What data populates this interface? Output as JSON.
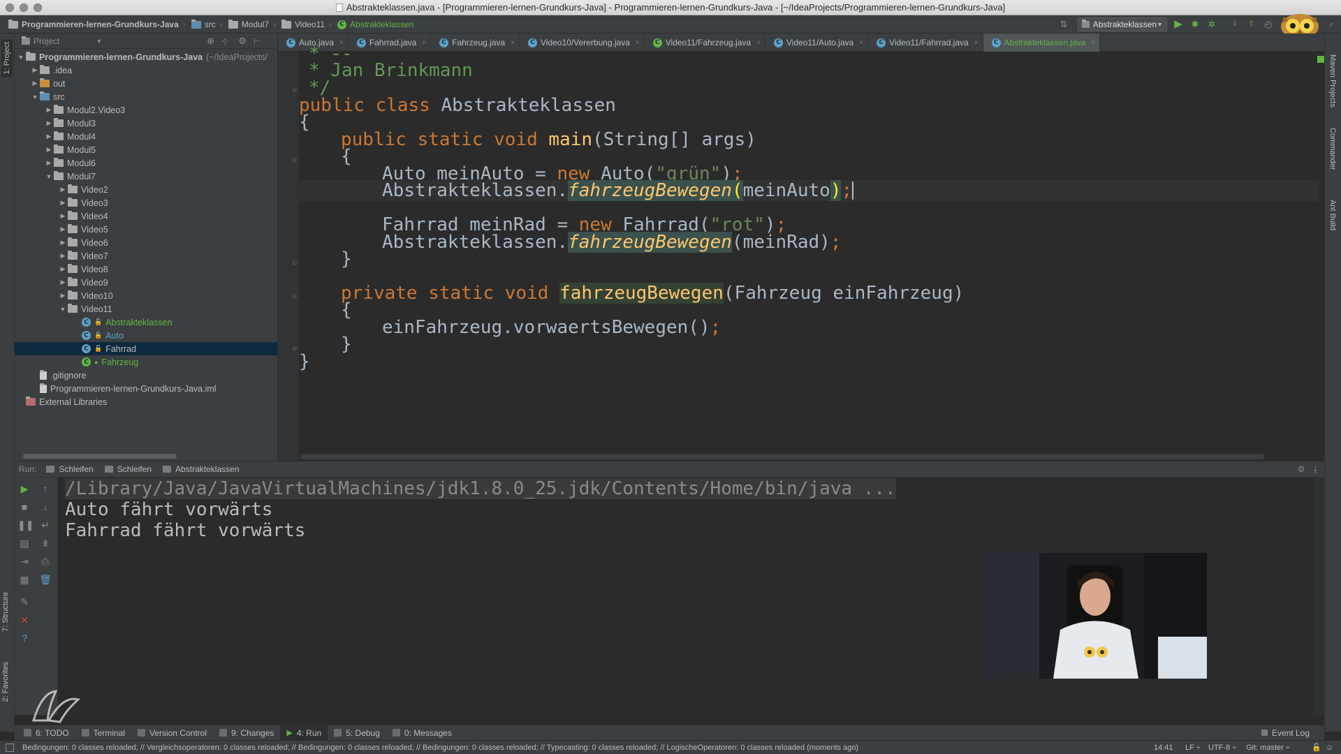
{
  "window": {
    "title": "Abstrakteklassen.java - [Programmieren-lernen-Grundkurs-Java] - Programmieren-lernen-Grundkurs-Java - [~/IdeaProjects/Programmieren-lernen-Grundkurs-Java]"
  },
  "navbar": {
    "crumbs": [
      "Programmieren-lernen-Grundkurs-Java",
      "src",
      "Modul7",
      "Video11",
      "Abstrakteklassen"
    ],
    "run_config": "Abstrakteklassen"
  },
  "left_stripe": {
    "project_tab": "1: Project",
    "structure_tab": "7: Structure",
    "favorites_tab": "2: Favorites"
  },
  "right_stripe": {
    "maven": "Maven Projects",
    "commander": "Commander",
    "ant": "Ant Build"
  },
  "project_panel": {
    "header": "Project",
    "root": "Programmieren-lernen-Grundkurs-Java",
    "root_path": "(~/IdeaProjects/",
    "tree": [
      {
        "label": ".idea",
        "level": 1,
        "state": "collapsed",
        "kind": "folder"
      },
      {
        "label": "out",
        "level": 1,
        "state": "collapsed",
        "kind": "folder-orange"
      },
      {
        "label": "src",
        "level": 1,
        "state": "expanded",
        "kind": "folder-blue"
      },
      {
        "label": "Modul2.Video3",
        "level": 2,
        "state": "collapsed",
        "kind": "folder"
      },
      {
        "label": "Modul3",
        "level": 2,
        "state": "collapsed",
        "kind": "folder"
      },
      {
        "label": "Modul4",
        "level": 2,
        "state": "collapsed",
        "kind": "folder"
      },
      {
        "label": "Modul5",
        "level": 2,
        "state": "collapsed",
        "kind": "folder"
      },
      {
        "label": "Modul6",
        "level": 2,
        "state": "collapsed",
        "kind": "folder"
      },
      {
        "label": "Modul7",
        "level": 2,
        "state": "expanded",
        "kind": "folder"
      },
      {
        "label": "Video2",
        "level": 3,
        "state": "collapsed",
        "kind": "folder"
      },
      {
        "label": "Video3",
        "level": 3,
        "state": "collapsed",
        "kind": "folder"
      },
      {
        "label": "Video4",
        "level": 3,
        "state": "collapsed",
        "kind": "folder"
      },
      {
        "label": "Video5",
        "level": 3,
        "state": "collapsed",
        "kind": "folder"
      },
      {
        "label": "Video6",
        "level": 3,
        "state": "collapsed",
        "kind": "folder"
      },
      {
        "label": "Video7",
        "level": 3,
        "state": "collapsed",
        "kind": "folder"
      },
      {
        "label": "Video8",
        "level": 3,
        "state": "collapsed",
        "kind": "folder"
      },
      {
        "label": "Video9",
        "level": 3,
        "state": "collapsed",
        "kind": "folder"
      },
      {
        "label": "Video10",
        "level": 3,
        "state": "collapsed",
        "kind": "folder"
      },
      {
        "label": "Video11",
        "level": 3,
        "state": "expanded",
        "kind": "folder"
      },
      {
        "label": "Abstrakteklassen",
        "level": 4,
        "state": "leaf",
        "kind": "class-green"
      },
      {
        "label": "Auto",
        "level": 4,
        "state": "leaf",
        "kind": "class-blue"
      },
      {
        "label": "Fahrrad",
        "level": 4,
        "state": "leaf",
        "kind": "class-selected"
      },
      {
        "label": "Fahrzeug",
        "level": 4,
        "state": "leaf",
        "kind": "class-abstract"
      },
      {
        "label": ".gitignore",
        "level": 1,
        "state": "leaf",
        "kind": "file"
      },
      {
        "label": "Programmieren-lernen-Grundkurs-Java.iml",
        "level": 1,
        "state": "leaf",
        "kind": "iml"
      },
      {
        "label": "External Libraries",
        "level": 0,
        "state": "leaf",
        "kind": "library"
      }
    ]
  },
  "editor_tabs": [
    {
      "label": "Auto.java",
      "active": false
    },
    {
      "label": "Fahrrad.java",
      "active": false
    },
    {
      "label": "Fahrzeug.java",
      "active": false
    },
    {
      "label": "Video10/Vererbung.java",
      "active": false
    },
    {
      "label": "Video11/Fahrzeug.java",
      "active": false
    },
    {
      "label": "Video11/Auto.java",
      "active": false
    },
    {
      "label": "Video11/Fahrrad.java",
      "active": false
    },
    {
      "label": "Abstrakteklassen.java",
      "active": true
    }
  ],
  "code": {
    "l1": "* --",
    "l2": "* Jan Brinkmann",
    "l3": "*/",
    "l4_kw": "public class ",
    "l4_name": "Abstrakteklassen",
    "l5": "{",
    "l6_kw": "public static void ",
    "l6_fn": "main",
    "l6_rest": "(String[] args)",
    "l7": "{",
    "l8_a": "Auto meinAuto = ",
    "l8_kw": "new ",
    "l8_b": "Auto(",
    "l8_str": "\"grün\"",
    "l8_c": ")",
    "l8_semi": ";",
    "l9_a": "Abstrakteklassen.",
    "l9_fn": "fahrzeugBewegen",
    "l9_open": "(",
    "l9_arg": "meinAuto",
    "l9_close": ")",
    "l9_semi": ";",
    "l11_a": "Fahrrad meinRad = ",
    "l11_kw": "new ",
    "l11_b": "Fahrrad(",
    "l11_str": "\"rot\"",
    "l11_c": ")",
    "l11_semi": ";",
    "l12_a": "Abstrakteklassen.",
    "l12_fn": "fahrzeugBewegen",
    "l12_rest": "(meinRad)",
    "l12_semi": ";",
    "l13": "}",
    "l15_kw": "private static void ",
    "l15_fn": "fahrzeugBewegen",
    "l15_rest": "(Fahrzeug einFahrzeug)",
    "l16": "{",
    "l17_a": "einFahrzeug.vorwaertsBewegen()",
    "l17_semi": ";",
    "l18": "}",
    "l19": "}"
  },
  "run_panel": {
    "label": "Run:",
    "tabs": [
      "Schleifen",
      "Schleifen",
      "Abstrakteklassen"
    ],
    "output": [
      "/Library/Java/JavaVirtualMachines/jdk1.8.0_25.jdk/Contents/Home/bin/java ...",
      "Auto fährt vorwärts",
      "Fahrrad fährt vorwärts"
    ]
  },
  "bottom_tabs": [
    {
      "label": "6: TODO",
      "active": false
    },
    {
      "label": "Terminal",
      "active": false
    },
    {
      "label": "Version Control",
      "active": false
    },
    {
      "label": "9: Changes",
      "active": false
    },
    {
      "label": "4: Run",
      "active": true
    },
    {
      "label": "5: Debug",
      "active": false
    },
    {
      "label": "0: Messages",
      "active": false
    }
  ],
  "event_log": "Event Log",
  "status": {
    "message": "Bedingungen: 0 classes reloaded; // Vergleichsoperatoren: 0 classes reloaded; // Bedingungen: 0 classes reloaded; // Bedingungen: 0 classes reloaded; // Typecasting: 0 classes reloaded; // LogischeOperatoren: 0 classes reloaded (moments ago)",
    "position": "14:41",
    "line_sep": "LF ÷",
    "encoding": "UTF-8 ÷",
    "git": "Git: master ÷"
  },
  "colors": {
    "keyword": "#cc7832",
    "string": "#6a8759",
    "comment": "#629755",
    "method": "#ffc66d",
    "accent_green": "#62b543"
  }
}
